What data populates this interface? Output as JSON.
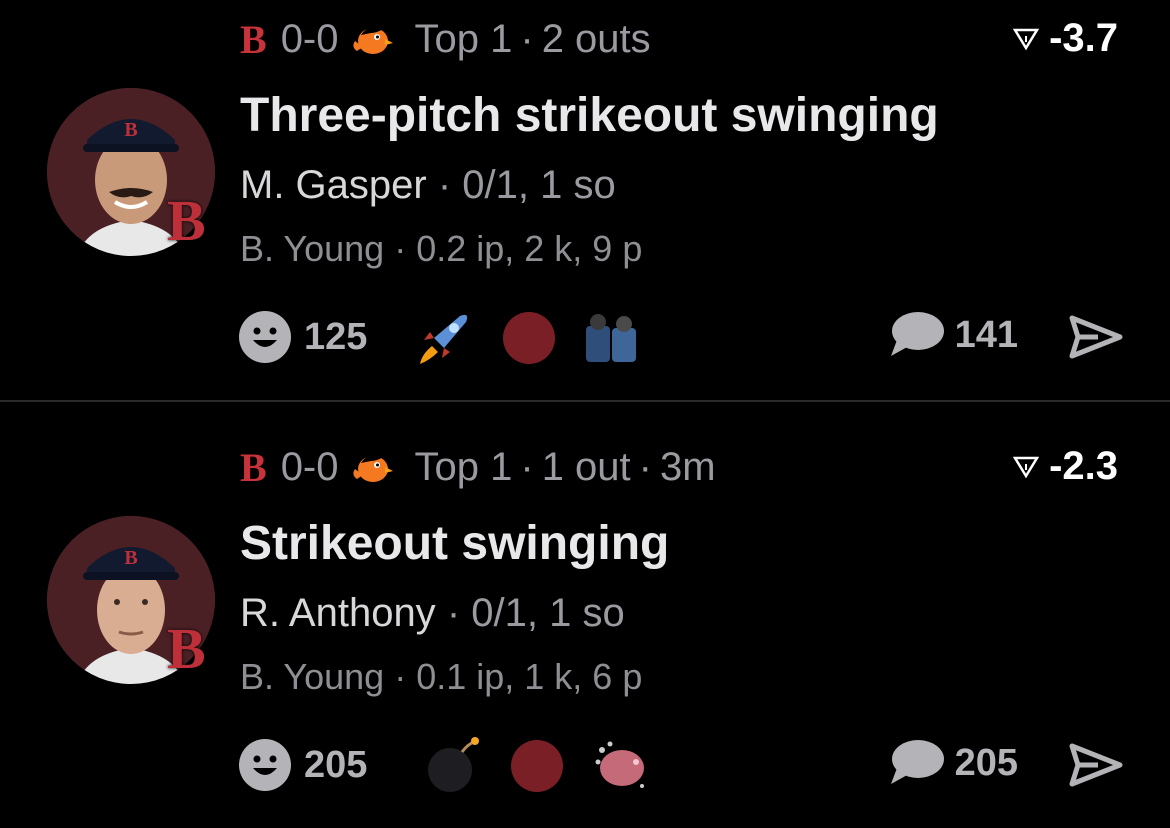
{
  "plays": [
    {
      "header": {
        "team_letter": "B",
        "score": "0-0",
        "inning": "Top 1",
        "separator": "·",
        "outs": "2 outs",
        "time": ""
      },
      "delta": "-3.7",
      "title": "Three-pitch strikeout swinging",
      "batter": {
        "name": "M. Gasper",
        "separator": "·",
        "stat": "0/1, 1 so"
      },
      "pitcher": {
        "name": "B. Young",
        "separator": "·",
        "stat": "0.2 ip, 2 k, 9 p"
      },
      "team_badge": "B",
      "reactions": {
        "count": "125",
        "emojis": [
          "rocket-emoji",
          "red-circle-emoji",
          "fans-sticker"
        ]
      },
      "comments": {
        "count": "141"
      }
    },
    {
      "header": {
        "team_letter": "B",
        "score": "0-0",
        "inning": "Top 1",
        "separator": "·",
        "outs": "1 out",
        "time": "3m"
      },
      "delta": "-2.3",
      "title": "Strikeout swinging",
      "batter": {
        "name": "R. Anthony",
        "separator": "·",
        "stat": "0/1, 1 so"
      },
      "pitcher": {
        "name": "B. Young",
        "separator": "·",
        "stat": "0.1 ip, 1 k, 6 p"
      },
      "team_badge": "B",
      "reactions": {
        "count": "205",
        "emojis": [
          "bomb-emoji",
          "red-circle-emoji",
          "splash-emoji"
        ]
      },
      "comments": {
        "count": "205"
      }
    }
  ],
  "colors": {
    "background": "#000000",
    "team_red": "#bd3039",
    "muted": "#9a9aa0",
    "divider": "#2a2a2a"
  }
}
